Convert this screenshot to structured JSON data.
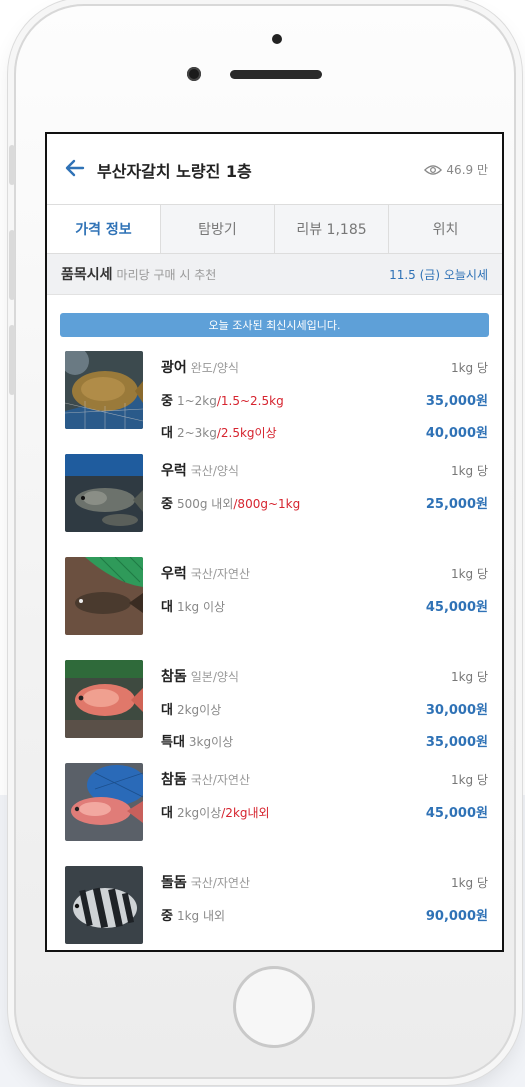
{
  "header": {
    "title": "부산자갈치 노량진 1층",
    "views": "46.9 만"
  },
  "tabs": [
    {
      "label": "가격 정보"
    },
    {
      "label": "탐방기"
    },
    {
      "label": "리뷰 1,185"
    },
    {
      "label": "위치"
    }
  ],
  "section": {
    "title": "품목시세",
    "subtitle": "마리당 구매 시 추천",
    "date": "11.5 (금) 오늘시세"
  },
  "notice": "오늘 조사된 최신시세입니다.",
  "items": [
    {
      "name": "광어",
      "origin": "완도/양식",
      "unit": "1kg 당",
      "rows": [
        {
          "grade": "중",
          "spec": "1~2kg",
          "spec_red": "/1.5~2.5kg",
          "price": "35,000원"
        },
        {
          "grade": "대",
          "spec": "2~3kg",
          "spec_red": "/2.5kg이상",
          "price": "40,000원"
        }
      ]
    },
    {
      "name": "우럭",
      "origin": "국산/양식",
      "unit": "1kg 당",
      "rows": [
        {
          "grade": "중",
          "spec": "500g 내외",
          "spec_red": "/800g~1kg",
          "price": "25,000원"
        }
      ]
    },
    {
      "name": "우럭",
      "origin": "국산/자연산",
      "unit": "1kg 당",
      "rows": [
        {
          "grade": "대",
          "spec": "1kg 이상",
          "spec_red": "",
          "price": "45,000원"
        }
      ]
    },
    {
      "name": "참돔",
      "origin": "일본/양식",
      "unit": "1kg 당",
      "rows": [
        {
          "grade": "대",
          "spec": "2kg이상",
          "spec_red": "",
          "price": "30,000원"
        },
        {
          "grade": "특대",
          "spec": "3kg이상",
          "spec_red": "",
          "price": "35,000원"
        }
      ]
    },
    {
      "name": "참돔",
      "origin": "국산/자연산",
      "unit": "1kg 당",
      "rows": [
        {
          "grade": "대",
          "spec": "2kg이상",
          "spec_red": "/2kg내외",
          "price": "45,000원"
        }
      ]
    },
    {
      "name": "돌돔",
      "origin": "국산/자연산",
      "unit": "1kg 당",
      "rows": [
        {
          "grade": "중",
          "spec": "1kg 내외",
          "spec_red": "",
          "price": "90,000원"
        }
      ]
    }
  ],
  "colors": {
    "accent": "#2f72b6",
    "notice_bg": "#5ea0d8",
    "highlight_red": "#d6242f"
  },
  "icons": {
    "back": "arrow-left-icon",
    "views": "eye-icon"
  }
}
